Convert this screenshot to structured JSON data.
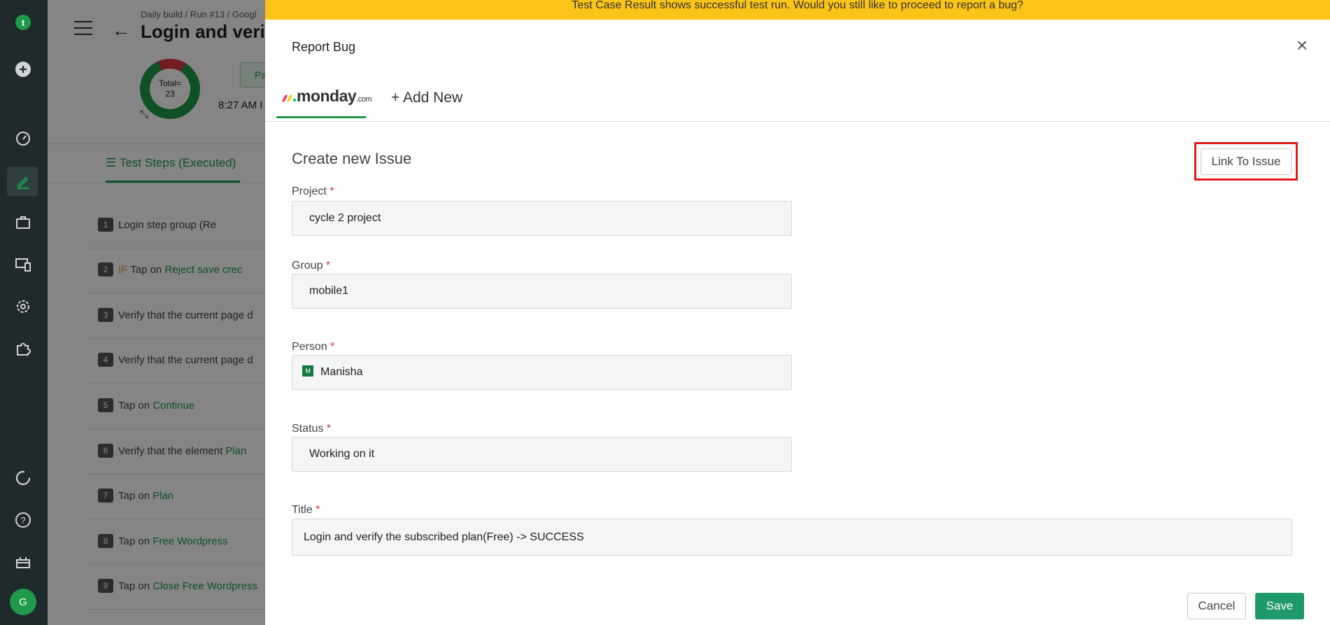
{
  "sidebar": {
    "icons": [
      "logo-icon",
      "plus-icon",
      "dashboard-icon",
      "edit-icon",
      "briefcase-icon",
      "devices-icon",
      "settings-icon",
      "puzzle-icon",
      "circle-icon",
      "help-icon",
      "gift-icon"
    ],
    "avatar_initial": "G"
  },
  "background": {
    "breadcrumb": "Daily build / Run #13 / Googl",
    "page_title": "Login and verify",
    "donut": {
      "total_label": "Total=",
      "total_value": "23",
      "pass_count_fraction": 0.92
    },
    "pass_button_label": "Pa",
    "time_text": "8:27 AM I",
    "steps_tab_label": "Test Steps (Executed)",
    "steps": [
      {
        "num": "1",
        "parts": [
          {
            "t": "Login step group (Re",
            "c": ""
          }
        ]
      },
      {
        "num": "2",
        "parts": [
          {
            "t": "IF ",
            "c": "ylw"
          },
          {
            "t": "Tap on  ",
            "c": ""
          },
          {
            "t": "Reject save crec",
            "c": "grn"
          }
        ]
      },
      {
        "num": "3",
        "parts": [
          {
            "t": "Verify that the current page d",
            "c": ""
          }
        ]
      },
      {
        "num": "4",
        "parts": [
          {
            "t": "Verify that the current page d",
            "c": ""
          }
        ]
      },
      {
        "num": "5",
        "parts": [
          {
            "t": "Tap on  ",
            "c": ""
          },
          {
            "t": "Continue",
            "c": "grn"
          }
        ]
      },
      {
        "num": "6",
        "parts": [
          {
            "t": "Verify that the element  ",
            "c": ""
          },
          {
            "t": "Plan",
            "c": "grn"
          }
        ]
      },
      {
        "num": "7",
        "parts": [
          {
            "t": "Tap on  ",
            "c": ""
          },
          {
            "t": "Plan",
            "c": "grn"
          }
        ]
      },
      {
        "num": "8",
        "parts": [
          {
            "t": "Tap on  ",
            "c": ""
          },
          {
            "t": "Free Wordpress",
            "c": "grn"
          }
        ]
      },
      {
        "num": "9",
        "parts": [
          {
            "t": "Tap on  ",
            "c": ""
          },
          {
            "t": "Close Free Wordpress",
            "c": "grn"
          }
        ]
      }
    ]
  },
  "modal": {
    "banner": "Test Case Result shows successful test run. Would you still like to proceed to report a bug?",
    "title": "Report Bug",
    "tabs": {
      "monday_word": "monday",
      "monday_suffix": ".com",
      "add_new": "+ Add New"
    },
    "section_title": "Create new Issue",
    "link_to_issue": "Link To Issue",
    "fields": {
      "project": {
        "label": "Project",
        "value": "cycle 2 project"
      },
      "group": {
        "label": "Group",
        "value": "mobile1"
      },
      "person": {
        "label": "Person",
        "value": "Manisha",
        "avatar": "M"
      },
      "status": {
        "label": "Status",
        "value": "Working on it"
      },
      "title": {
        "label": "Title",
        "value": "Login and verify the subscribed plan(Free) -> SUCCESS"
      }
    },
    "required_mark": "*",
    "cancel": "Cancel",
    "save": "Save"
  },
  "colors": {
    "accent": "#1e9a4a",
    "banner": "#fcc419",
    "nav_bg": "#1e2a2b",
    "highlight": "#e21b1b"
  }
}
